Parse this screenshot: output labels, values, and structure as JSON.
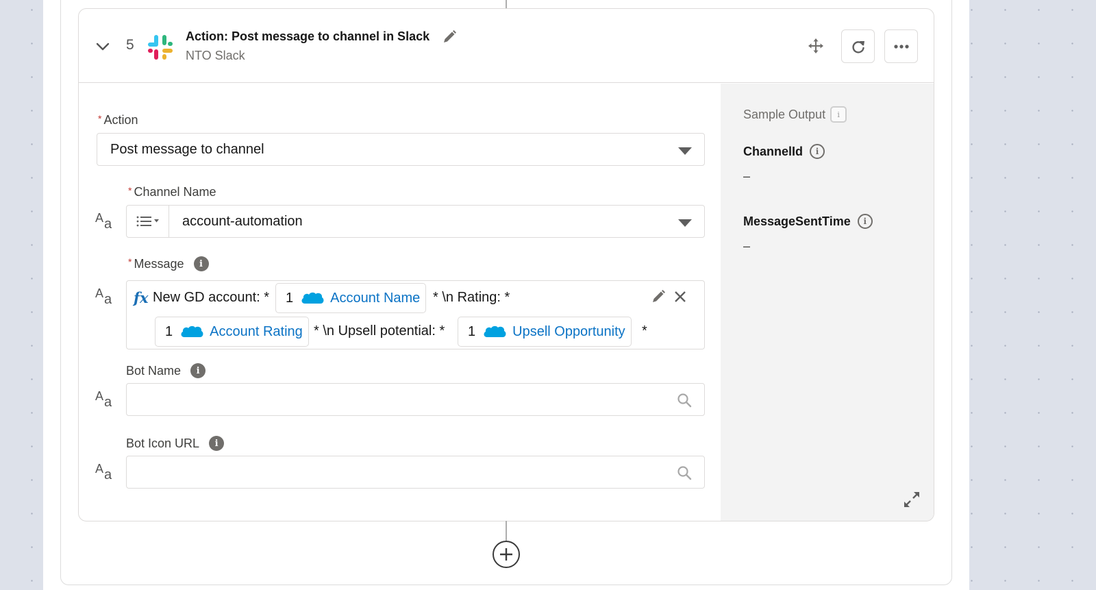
{
  "step": {
    "number": "5",
    "title": "Action: Post message to channel in Slack",
    "subtitle": "NTO Slack",
    "icons": {
      "collapse": "chevron-down-icon",
      "app": "slack-logo",
      "edit": "pencil-icon",
      "move": "move-icon",
      "refresh": "refresh-icon",
      "more": "more-options-icon"
    }
  },
  "form": {
    "action": {
      "label": "Action",
      "required_mark": "*",
      "value": "Post message to channel"
    },
    "channel_name": {
      "label": "Channel Name",
      "required_mark": "*",
      "type_icon_A": "A",
      "type_icon_a": "a",
      "value": "account-automation"
    },
    "message": {
      "label": "Message",
      "required_mark": "*",
      "info_glyph": "i",
      "type_icon_A": "A",
      "type_icon_a": "a",
      "formula_prefix": "fx",
      "segments": {
        "text1": "New GD account: *",
        "chip1": {
          "num": "1",
          "label": "Account Name"
        },
        "text2": "* \\n Rating: *",
        "chip2": {
          "num": "1",
          "label": "Account Rating"
        },
        "text3": "* \\n Upsell potential: *",
        "chip3": {
          "num": "1",
          "label": "Upsell Opportunity"
        },
        "text4": "*"
      }
    },
    "bot_name": {
      "label": "Bot Name",
      "info_glyph": "i",
      "type_icon_A": "A",
      "type_icon_a": "a",
      "value": ""
    },
    "bot_icon_url": {
      "label": "Bot Icon URL",
      "info_glyph": "i",
      "type_icon_A": "A",
      "type_icon_a": "a",
      "value": ""
    }
  },
  "sample_output": {
    "title": "Sample Output",
    "info_glyph": "i",
    "fields": [
      {
        "name": "ChannelId",
        "value": "–"
      },
      {
        "name": "MessageSentTime",
        "value": "–"
      }
    ]
  },
  "colors": {
    "link_blue": "#0b73c5",
    "required_red": "#c23934",
    "salesforce_blue": "#00a1e0",
    "canvas_bg": "#dde1ea",
    "sample_panel_bg": "#f3f3f3"
  }
}
